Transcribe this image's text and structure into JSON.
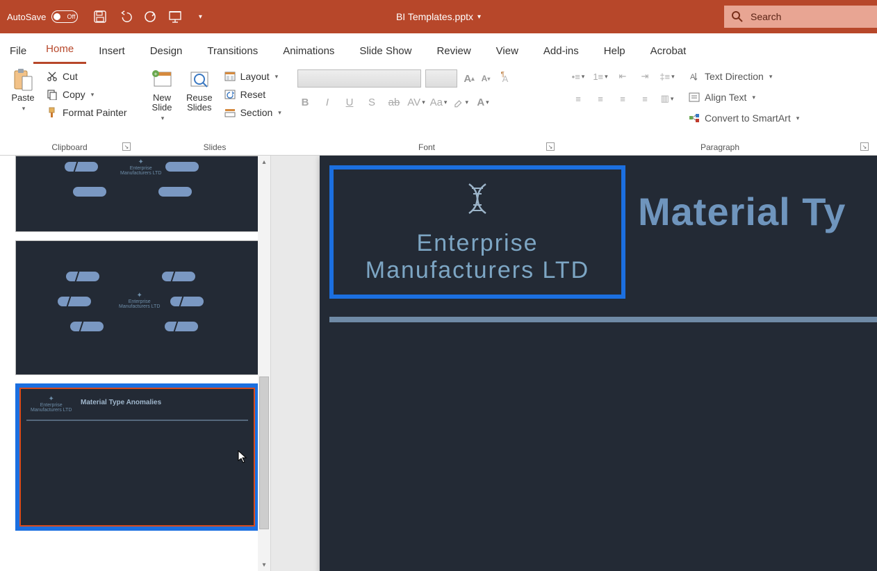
{
  "titlebar": {
    "autosave_label": "AutoSave",
    "autosave_state": "Off",
    "filename": "BI Templates.pptx"
  },
  "search": {
    "placeholder": "Search"
  },
  "tabs": {
    "file": "File",
    "home": "Home",
    "insert": "Insert",
    "design": "Design",
    "transitions": "Transitions",
    "animations": "Animations",
    "slideshow": "Slide Show",
    "review": "Review",
    "view": "View",
    "addins": "Add-ins",
    "help": "Help",
    "acrobat": "Acrobat"
  },
  "ribbon": {
    "clipboard": {
      "paste": "Paste",
      "cut": "Cut",
      "copy": "Copy",
      "format_painter": "Format Painter",
      "group": "Clipboard"
    },
    "slides": {
      "new_slide": "New\nSlide",
      "reuse": "Reuse\nSlides",
      "layout": "Layout",
      "reset": "Reset",
      "section": "Section",
      "group": "Slides"
    },
    "font": {
      "group": "Font"
    },
    "paragraph": {
      "group": "Paragraph",
      "text_direction": "Text Direction",
      "align_text": "Align Text",
      "convert_smartart": "Convert to SmartArt"
    }
  },
  "slide_content": {
    "company_line1": "Enterprise",
    "company_line2": "Manufacturers LTD",
    "title": "Material Ty"
  },
  "thumbs": {
    "t3_title": "Material Type Anomalies",
    "mini_company": "Enterprise\nManufacturers LTD"
  }
}
